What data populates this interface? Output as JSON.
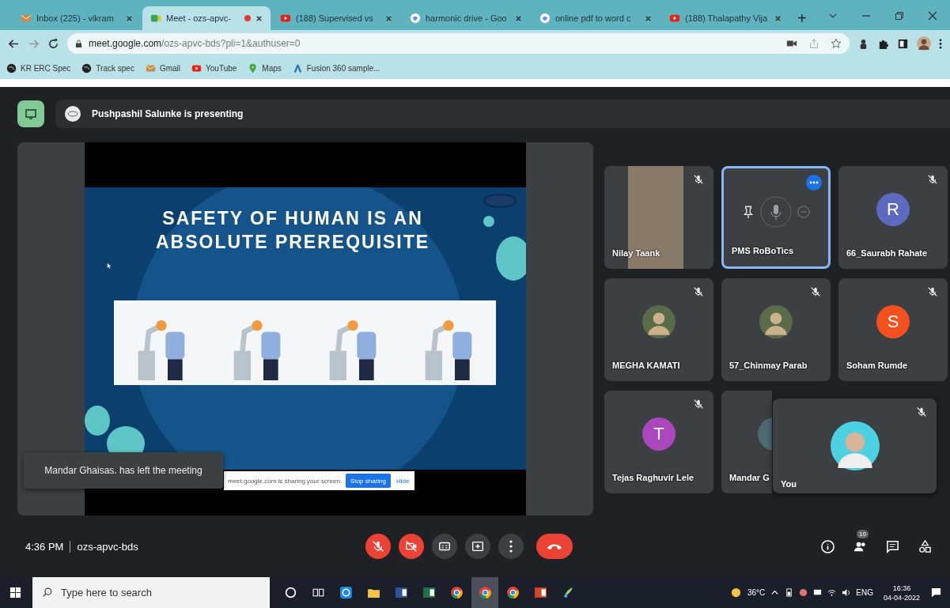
{
  "browser": {
    "tabs": [
      {
        "title": "Inbox (225) - vikram",
        "kind": "mail",
        "selected": false,
        "recording": false
      },
      {
        "title": "Meet - ozs-apvc-",
        "kind": "meet",
        "selected": true,
        "recording": true
      },
      {
        "title": "(188) Supervised vs",
        "kind": "youtube",
        "selected": false,
        "recording": false
      },
      {
        "title": "harmonic drive - Goo",
        "kind": "google",
        "selected": false,
        "recording": false
      },
      {
        "title": "online pdf to word c",
        "kind": "google",
        "selected": false,
        "recording": false
      },
      {
        "title": "(188) Thalapathy Vija",
        "kind": "youtube",
        "selected": false,
        "recording": false
      }
    ],
    "new_tab": "+",
    "address": {
      "host": "meet.google.com",
      "path": "/ozs-apvc-bds?pli=1&authuser=0"
    },
    "bookmarks": [
      {
        "label": "KR ERC Spec",
        "kind": "globe"
      },
      {
        "label": "Track spec",
        "kind": "globe"
      },
      {
        "label": "Gmail",
        "kind": "mail"
      },
      {
        "label": "YouTube",
        "kind": "youtube"
      },
      {
        "label": "Maps",
        "kind": "pin"
      },
      {
        "label": "Fusion 360 sample...",
        "kind": "fusion"
      }
    ]
  },
  "meet": {
    "presenting": "Pushpashil Salunke is presenting",
    "slide": {
      "title_lines": [
        "SAFETY OF HUMAN IS AN",
        "ABSOLUTE PREREQUISITE"
      ]
    },
    "share_bar": {
      "message": "meet.google.com is sharing your screen.",
      "stop": "Stop sharing",
      "hide": "Hide"
    },
    "toast": "Mandar Ghaisas. has left the meeting",
    "tiles": [
      {
        "name": "Nilay Taank",
        "kind": "video",
        "muted": true,
        "selected": false
      },
      {
        "name": "PMS RoBoTics",
        "kind": "hover",
        "muted": false,
        "selected": true
      },
      {
        "name": "66_Saurabh Rahate",
        "kind": "letter",
        "letter": "R",
        "color": "#5c6bc0",
        "muted": true,
        "selected": false
      },
      {
        "name": "MEGHA KAMATI",
        "kind": "photo",
        "muted": true,
        "selected": false
      },
      {
        "name": "57_Chinmay Parab",
        "kind": "photo",
        "muted": true,
        "selected": false
      },
      {
        "name": "Soham Rumde",
        "kind": "letter",
        "letter": "S",
        "color": "#f4511e",
        "muted": true,
        "selected": false
      },
      {
        "name": "Tejas Raghuvir Lele",
        "kind": "letter",
        "letter": "T",
        "color": "#ab47bc",
        "muted": true,
        "selected": false
      },
      {
        "name": "Mandar G",
        "kind": "partial",
        "color": "#4e6a70",
        "muted": false,
        "selected": false
      }
    ],
    "self": {
      "label": "You",
      "muted": true
    },
    "time": "4:36 PM",
    "code": "ozs-apvc-bds",
    "controls": [
      {
        "kind": "mic",
        "on": false
      },
      {
        "kind": "camera",
        "on": false
      },
      {
        "kind": "captions"
      },
      {
        "kind": "present"
      },
      {
        "kind": "more"
      },
      {
        "kind": "hangup"
      }
    ],
    "people_count": "10"
  },
  "taskbar": {
    "search_placeholder": "Type here to search",
    "temperature": "36°C",
    "language": "ENG",
    "time": "16:36",
    "date": "04-04-2022"
  }
}
